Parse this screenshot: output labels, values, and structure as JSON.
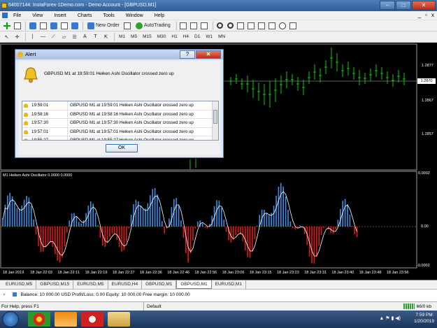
{
  "window": {
    "title": "64007144: InstaForex-1Demo.com - Demo Account - [GBPUSD,M1]",
    "minimize": "–",
    "maximize": "□",
    "close": "✕"
  },
  "menu": [
    "File",
    "View",
    "Insert",
    "Charts",
    "Tools",
    "Window",
    "Help"
  ],
  "toolbar": {
    "new_order": "New Order",
    "autotrading": "AutoTrading",
    "timeframes": [
      "M1",
      "M5",
      "M15",
      "M30",
      "H1",
      "H4",
      "D1",
      "W1",
      "MN"
    ]
  },
  "chart": {
    "symbol_timeframe": "GBPUSD,M1",
    "price_labels": [
      "1.2877",
      "1.2870",
      "1.2867",
      "1.2857"
    ],
    "current_price": "1.2870",
    "oscillator_title": "M1  Heiken Ashi Oscillator 0.0000 0.0000",
    "osc_axis_labels": [
      "0.0002",
      "0.00",
      "-0.0002"
    ],
    "time_labels": [
      "18 Jan 2019",
      "18 Jan 22:03",
      "18 Jan 22:11",
      "18 Jan 22:19",
      "18 Jan 22:27",
      "18 Jan 22:36",
      "18 Jan 22:46",
      "18 Jan 22:56",
      "18 Jan 23:06",
      "18 Jan 23:15",
      "18 Jan 23:23",
      "18 Jan 23:31",
      "18 Jan 23:40",
      "18 Jan 23:48",
      "18 Jan 23:56"
    ],
    "colors": {
      "up_bar": "#3a8fe8",
      "down_bar": "#e01818",
      "signal": "#ffffff",
      "candles": "#00cc00",
      "zero_line": "#c8a000"
    }
  },
  "alert_dialog": {
    "title": "Alert",
    "help_button": "?",
    "close_button": "✕",
    "message": "GBPUSD M1 at 19:59:01 Heiken Ashi Oscillator crossed zero up",
    "rows": [
      {
        "time": "19:59:01",
        "message": "GBPUSD M1 at 19:59:01 Heiken Ashi Oscillator crossed zero up"
      },
      {
        "time": "19:58:16",
        "message": "GBPUSD M1 at 19:58:16 Heiken Ashi Oscillator crossed zero up"
      },
      {
        "time": "19:57:30",
        "message": "GBPUSD M1 at 19:57:30 Heiken Ashi Oscillator crossed zero up"
      },
      {
        "time": "19:57:01",
        "message": "GBPUSD M1 at 19:57:01 Heiken Ashi Oscillator crossed zero up"
      },
      {
        "time": "19:55:27",
        "message": "GBPUSD M1 at 19:55:27 Heiken Ashi Oscillator crossed zero up"
      }
    ],
    "ok_label": "OK"
  },
  "tabs": [
    {
      "label": "EURUSD,M5",
      "active": false
    },
    {
      "label": "GBPUSD,M15",
      "active": false
    },
    {
      "label": "EURUSD,M5",
      "active": false
    },
    {
      "label": "EURUSD,H4",
      "active": false
    },
    {
      "label": "GBPUSD,M1",
      "active": false
    },
    {
      "label": "GBPUSD,M1",
      "active": true
    },
    {
      "label": "EURUSD,M1",
      "active": false
    }
  ],
  "terminal": {
    "balance_line": "Balance: 10 000.00 USD  Profit/Loss: 0.00  Equity: 10 000.00  Free margin: 10 000.00"
  },
  "status": {
    "help": "For Help, press F1",
    "profile": "Default",
    "connection": "66/0 kb"
  },
  "taskbar": {
    "time": "7:59 PM",
    "date": "1/20/2019"
  }
}
